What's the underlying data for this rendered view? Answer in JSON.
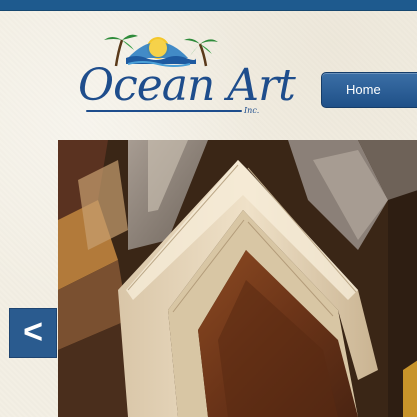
{
  "logo": {
    "text": "Ocean Art",
    "suffix": "Inc."
  },
  "nav": {
    "home_label": "Home"
  },
  "slider": {
    "image_alt": "Wooden picture frame moulding samples",
    "prev_label": "<"
  },
  "icons": {
    "logo_emblem": "sun-palm-trees-ocean-icon",
    "prev": "chevron-left-icon"
  },
  "colors": {
    "brand_blue": "#1e4d8c",
    "top_bar": "#1e5a8e",
    "button": "#2a5b8f",
    "background": "#f3efe4"
  }
}
